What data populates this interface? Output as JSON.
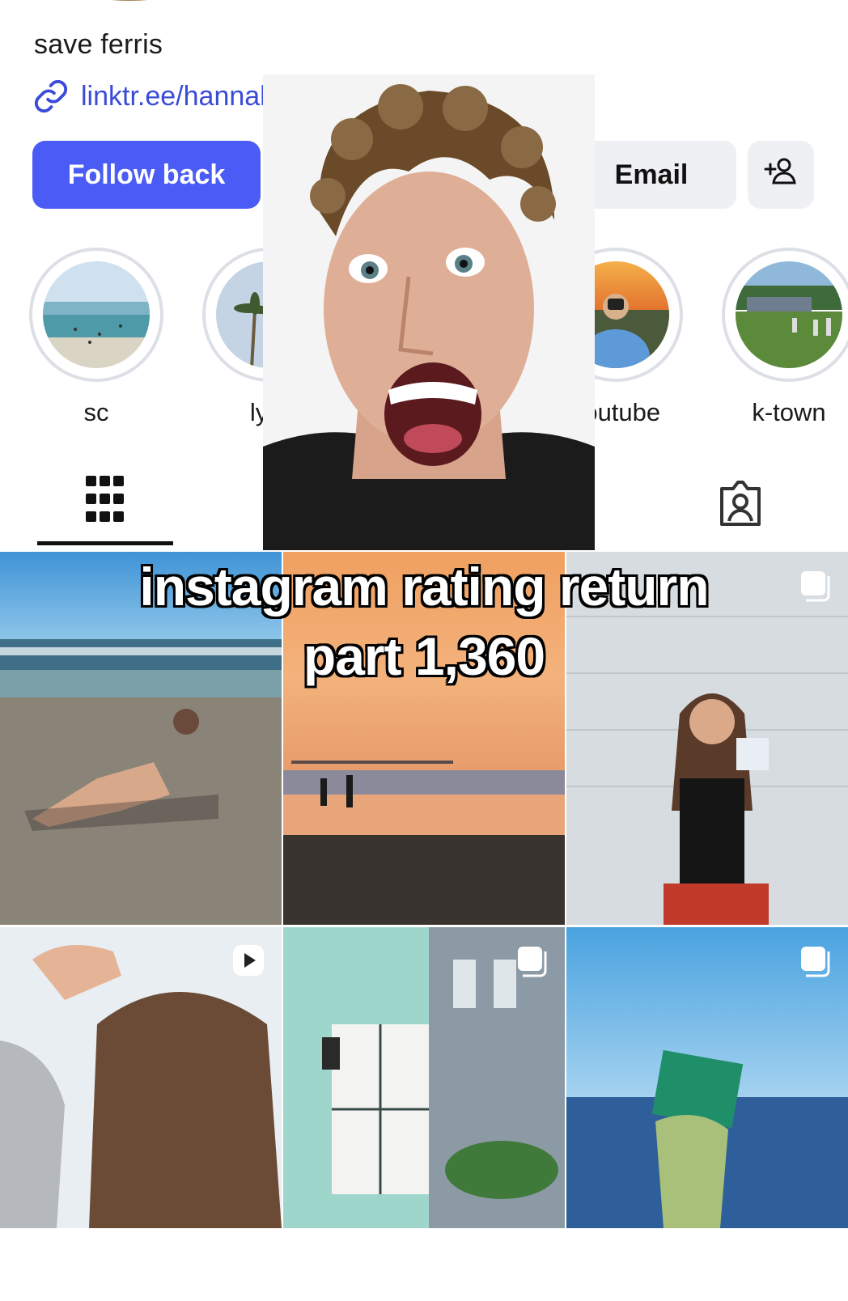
{
  "profile": {
    "bio": "save ferris",
    "link": "linktr.ee/hannahismo",
    "icons": {
      "link": "link-icon",
      "add_user": "add-user-icon"
    }
  },
  "actions": {
    "follow_back": "Follow back",
    "email": "Email"
  },
  "highlights": [
    {
      "label": "sc"
    },
    {
      "label": "lyfe"
    },
    {
      "label": "youtube"
    },
    {
      "label": "k-town"
    }
  ],
  "tabs": {
    "grid": "grid-icon",
    "tagged": "tagged-icon"
  },
  "caption": {
    "line1": "instagram rating return",
    "line2": "part 1,360"
  },
  "posts": [
    {
      "badge": "carousel-icon"
    },
    {
      "badge": ""
    },
    {
      "badge": ""
    },
    {
      "badge": "reel-icon"
    },
    {
      "badge": "carousel-icon"
    },
    {
      "badge": "carousel-icon"
    }
  ],
  "colors": {
    "accent": "#4a5cf5",
    "link": "#3a4bd8",
    "button_secondary": "#eef0f3"
  }
}
